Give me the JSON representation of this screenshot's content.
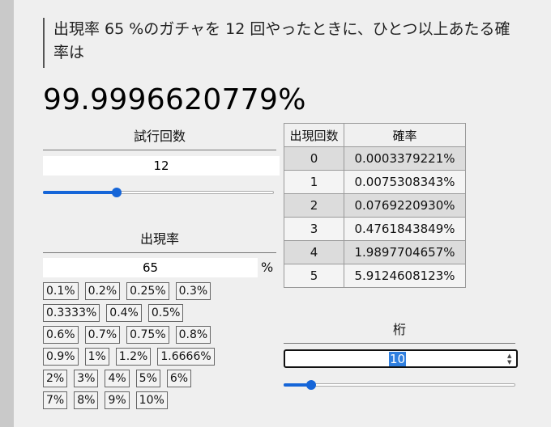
{
  "question": "出現率 65 %のガチャを 12 回やったときに、ひとつ以上あたる確率は",
  "result": "99.9996620779%",
  "trials": {
    "title": "試行回数",
    "value": "12",
    "slider_fraction": 0.32
  },
  "rate": {
    "title": "出現率",
    "value": "65",
    "unit": "%",
    "presets": [
      [
        "0.1%",
        "0.2%",
        "0.25%",
        "0.3%"
      ],
      [
        "0.3333%",
        "0.4%",
        "0.5%"
      ],
      [
        "0.6%",
        "0.7%",
        "0.75%",
        "0.8%"
      ],
      [
        "0.9%",
        "1%",
        "1.2%",
        "1.6666%"
      ],
      [
        "2%",
        "3%",
        "4%",
        "5%",
        "6%"
      ],
      [
        "7%",
        "8%",
        "9%",
        "10%"
      ]
    ]
  },
  "table": {
    "headers": [
      "出現回数",
      "確率"
    ],
    "rows": [
      [
        "0",
        "0.0003379221%"
      ],
      [
        "1",
        "0.0075308343%"
      ],
      [
        "2",
        "0.0769220930%"
      ],
      [
        "3",
        "0.4761843849%"
      ],
      [
        "4",
        "1.9897704657%"
      ],
      [
        "5",
        "5.9124608123%"
      ]
    ]
  },
  "digits": {
    "title": "桁",
    "value": "10",
    "slider_fraction": 0.12
  },
  "colors": {
    "accent": "#1565d8",
    "background": "#efefef",
    "selection": "#2f7fdf"
  }
}
